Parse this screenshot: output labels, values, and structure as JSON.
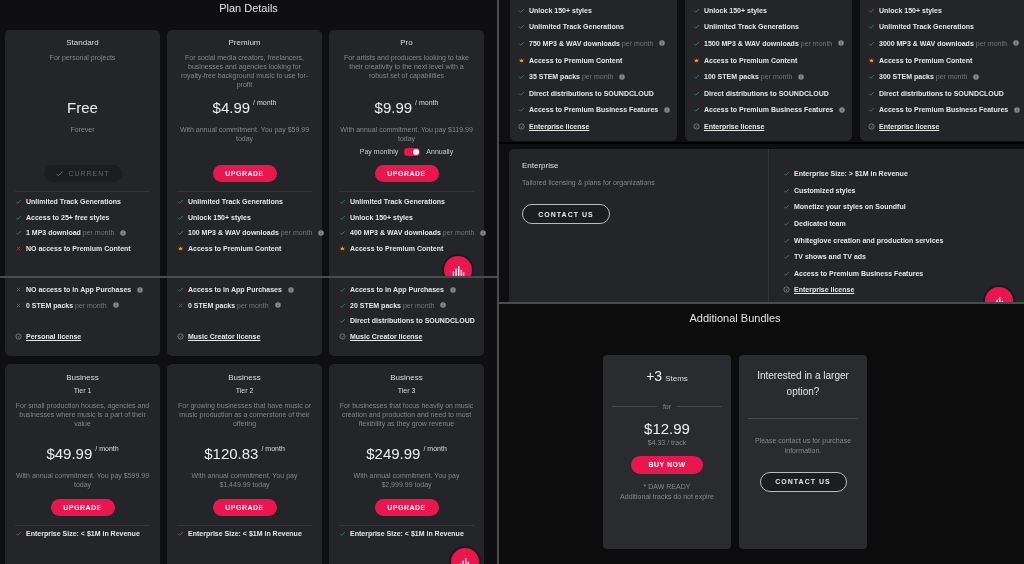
{
  "plan_details": {
    "title": "Plan Details",
    "plans": [
      {
        "name": "Standard",
        "description": "For personal projects",
        "price": "Free",
        "note": "Forever",
        "button": {
          "label": "CURRENT",
          "kind": "current"
        },
        "features": [
          {
            "kind": "check",
            "text": "Unlimited Track Generations"
          },
          {
            "kind": "check",
            "text": "Access to 25+ free styles"
          },
          {
            "kind": "check",
            "text": "1 MP3 download",
            "suffix": "per month",
            "info": true
          },
          {
            "kind": "cross",
            "text": "NO access to Premium Content"
          }
        ]
      },
      {
        "name": "Premium",
        "description": "For social media creators, freelancers, businesses and agencies looking for royalty-free background music to use for-profit",
        "price": "$4.99",
        "period": "/ month",
        "note": "With annual commitment. You pay $59.99 today",
        "button": {
          "label": "UPGRADE",
          "kind": "upgrade"
        },
        "features": [
          {
            "kind": "check",
            "text": "Unlimited Track Generations"
          },
          {
            "kind": "check",
            "text": "Unlock 150+ styles"
          },
          {
            "kind": "check",
            "text": "100 MP3 & WAV downloads",
            "suffix": "per month",
            "info": true
          },
          {
            "kind": "crown",
            "text": "Access to Premium Content"
          }
        ]
      },
      {
        "name": "Pro",
        "description": "For artists and producers looking to take their creativity to the next level with a robust set of capabilities",
        "price": "$9.99",
        "period": "/ month",
        "note": "With annual commitment. You pay $119.99 today",
        "toggle": {
          "left": "Pay monthly",
          "right": "Annually",
          "on": true
        },
        "button": {
          "label": "UPGRADE",
          "kind": "upgrade"
        },
        "features": [
          {
            "kind": "check",
            "text": "Unlimited Track Generations"
          },
          {
            "kind": "check",
            "text": "Unlock 150+ styles"
          },
          {
            "kind": "check",
            "text": "400 MP3 & WAV downloads",
            "suffix": "per month",
            "info": true
          },
          {
            "kind": "crown",
            "text": "Access to Premium Content"
          }
        ]
      }
    ]
  },
  "plan_details_continued": [
    {
      "features": [
        {
          "kind": "cross",
          "text": "NO access to in App Purchases",
          "info": true
        },
        {
          "kind": "cross",
          "text": "0 STEM packs",
          "suffix": "per month",
          "info": true
        }
      ],
      "license": "Personal license"
    },
    {
      "features": [
        {
          "kind": "check",
          "text": "Access to in App Purchases",
          "info": true
        },
        {
          "kind": "cross",
          "text": "0 STEM packs",
          "suffix": "per month",
          "info": true
        }
      ],
      "license": "Music Creator license"
    },
    {
      "features": [
        {
          "kind": "check",
          "text": "Access to in App Purchases",
          "info": true
        },
        {
          "kind": "check",
          "text": "20 STEM packs",
          "suffix": "per month",
          "info": true
        },
        {
          "kind": "check",
          "text": "Direct distributions to SOUNDCLOUD"
        }
      ],
      "license": "Music Creator license"
    }
  ],
  "business_plans": [
    {
      "name": "Business",
      "tier": "Tier 1",
      "description": "For small production houses, agencies and businesses where music is a part of their value",
      "price": "$49.99",
      "period": "/ month",
      "note": "With annual commitment. You pay $599.99 today",
      "button": "UPGRADE",
      "features": [
        {
          "kind": "check",
          "text": "Enterprise Size: < $1M in Revenue"
        }
      ]
    },
    {
      "name": "Business",
      "tier": "Tier 2",
      "description": "For growing businesses that have music or music production as a cornerstone of their offering",
      "price": "$120.83",
      "period": "/ month",
      "note": "With annual commitment. You pay $1,449.99 today",
      "button": "UPGRADE",
      "features": [
        {
          "kind": "check",
          "text": "Enterprise Size: < $1M in Revenue"
        }
      ]
    },
    {
      "name": "Business",
      "tier": "Tier 3",
      "description": "For businesses that focus heavily on music creation and production and need to most flexibility as they grow revenue",
      "price": "$249.99",
      "period": "/ month",
      "note": "With annual commitment. You pay $2,999.99 today",
      "button": "UPGRADE",
      "features": [
        {
          "kind": "check",
          "text": "Enterprise Size: < $1M in Revenue"
        }
      ]
    }
  ],
  "business_features_continued": [
    {
      "features": [
        {
          "kind": "check",
          "text": "Unlock 150+ styles"
        },
        {
          "kind": "check",
          "text": "Unlimited Track Generations"
        },
        {
          "kind": "check",
          "text": "750 MP3 & WAV downloads",
          "suffix": "per month",
          "info": true
        },
        {
          "kind": "crown",
          "text": "Access to Premium Content"
        },
        {
          "kind": "check",
          "text": "35 STEM packs",
          "suffix": "per month",
          "info": true
        },
        {
          "kind": "check",
          "text": "Direct distributions to SOUNDCLOUD"
        },
        {
          "kind": "check",
          "text": "Access to Premium Business Features",
          "info": true
        }
      ],
      "license": "Enterprise license"
    },
    {
      "features": [
        {
          "kind": "check",
          "text": "Unlock 150+ styles"
        },
        {
          "kind": "check",
          "text": "Unlimited Track Generations"
        },
        {
          "kind": "check",
          "text": "1500 MP3 & WAV downloads",
          "suffix": "per month",
          "info": true
        },
        {
          "kind": "crown",
          "text": "Access to Premium Content"
        },
        {
          "kind": "check",
          "text": "100 STEM packs",
          "suffix": "per month",
          "info": true
        },
        {
          "kind": "check",
          "text": "Direct distributions to SOUNDCLOUD"
        },
        {
          "kind": "check",
          "text": "Access to Premium Business Features",
          "info": true
        }
      ],
      "license": "Enterprise license"
    },
    {
      "features": [
        {
          "kind": "check",
          "text": "Unlock 150+ styles"
        },
        {
          "kind": "check",
          "text": "Unlimited Track Generations"
        },
        {
          "kind": "check",
          "text": "3000 MP3 & WAV downloads",
          "suffix": "per month",
          "info": true
        },
        {
          "kind": "crown",
          "text": "Access to Premium Content"
        },
        {
          "kind": "check",
          "text": "300 STEM packs",
          "suffix": "per month",
          "info": true
        },
        {
          "kind": "check",
          "text": "Direct distributions to SOUNDCLOUD"
        },
        {
          "kind": "check",
          "text": "Access to Premium Business Features",
          "info": true
        }
      ],
      "license": "Enterprise license"
    }
  ],
  "enterprise": {
    "name": "Enterprise",
    "description": "Tailored licensing & plans for organizations",
    "button": "CONTACT US",
    "features": [
      {
        "kind": "check",
        "text": "Enterprise Size: > $1M in Revenue"
      },
      {
        "kind": "check",
        "text": "Customized styles"
      },
      {
        "kind": "check",
        "text": "Monetize your styles on Soundful"
      },
      {
        "kind": "check",
        "text": "Dedicated team"
      },
      {
        "kind": "check",
        "text": "Whiteglove creation and production services"
      },
      {
        "kind": "check",
        "text": "TV shows and TV ads"
      },
      {
        "kind": "check",
        "text": "Access to Premium Business Features"
      }
    ],
    "license": "Enterprise license"
  },
  "additional_bundles": {
    "title": "Additional Bundles",
    "bundle": {
      "amount": "+3",
      "unit": "Stems",
      "divider_label": "for",
      "price": "$12.99",
      "per_track": "$4.33 / track",
      "button": "BUY NOW",
      "notes": [
        "* DAW READY",
        "Additional tracks do not expire"
      ]
    },
    "contact": {
      "title": "Interested in a larger option?",
      "text": "Please contact us for purchase information.",
      "button": "CONTACT US"
    }
  }
}
